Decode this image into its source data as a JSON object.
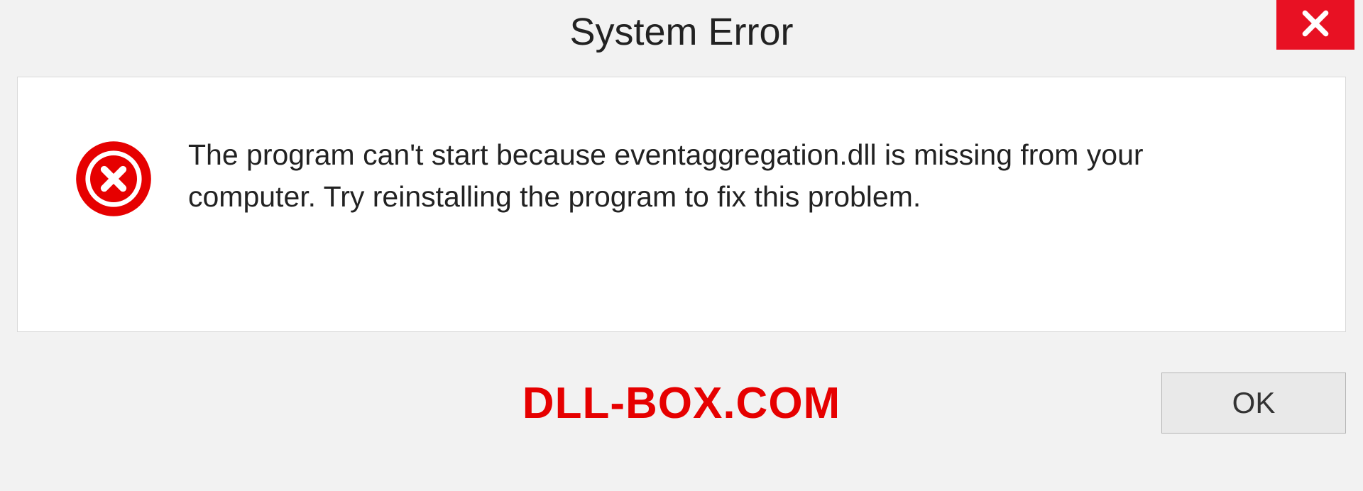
{
  "dialog": {
    "title": "System Error",
    "message": "The program can't start because eventaggregation.dll is missing from your computer. Try reinstalling the program to fix this problem.",
    "ok_label": "OK"
  },
  "watermark": "DLL-BOX.COM"
}
